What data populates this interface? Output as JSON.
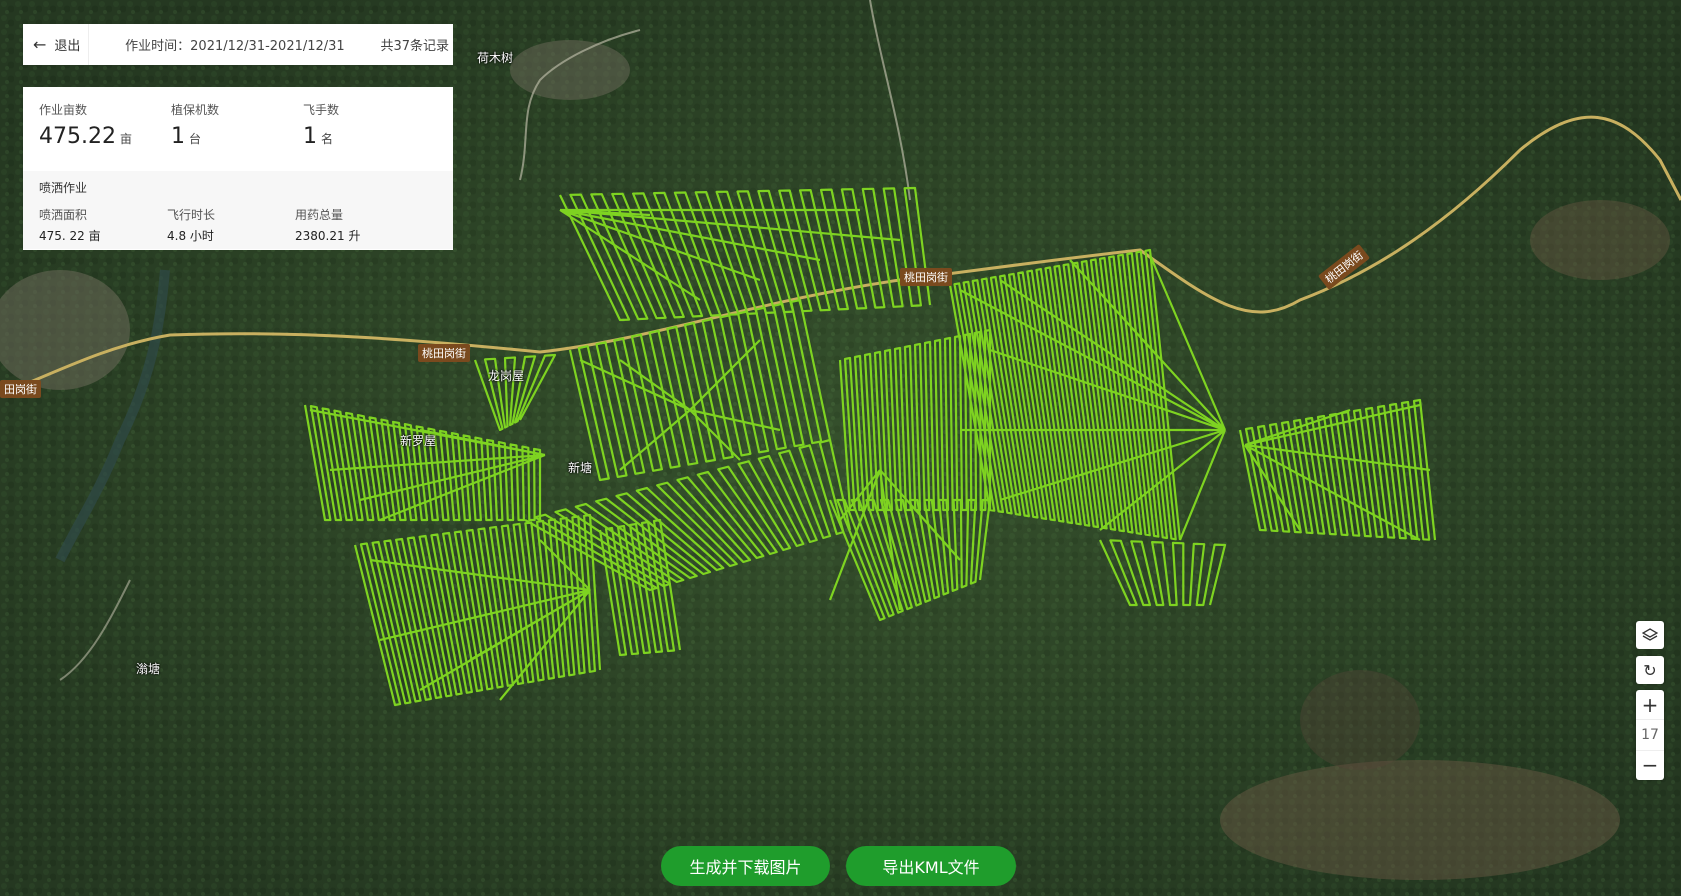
{
  "header": {
    "back_label": "退出",
    "work_time": "作业时间：2021/12/31-2021/12/31",
    "record_count": "共37条记录"
  },
  "stats": {
    "area_label": "作业亩数",
    "area_value": "475.22",
    "area_unit": "亩",
    "machine_label": "植保机数",
    "machine_value": "1",
    "machine_unit": "台",
    "pilot_label": "飞手数",
    "pilot_value": "1",
    "pilot_unit": "名",
    "section_title": "喷洒作业",
    "spray_area_label": "喷洒面积",
    "spray_area_value": "475. 22 亩",
    "flight_time_label": "飞行时长",
    "flight_time_value": "4.8 小时",
    "pesticide_label": "用药总量",
    "pesticide_value": "2380.21 升"
  },
  "map": {
    "zoom_level": "17",
    "zoom_in_label": "+",
    "zoom_out_label": "−",
    "place_labels": [
      "荷木树",
      "新罗屋",
      "新塘",
      "滃塘",
      "龙岗屋"
    ],
    "road_labels": [
      "桃田岗街",
      "桃田岗街",
      "桃田岗街",
      "田岗街"
    ],
    "track_color": "#7ed321",
    "road_color": "#c8b060"
  },
  "actions": {
    "download_image": "生成并下载图片",
    "export_kml": "导出KML文件"
  },
  "colors": {
    "button_green": "#1f9d2c"
  }
}
